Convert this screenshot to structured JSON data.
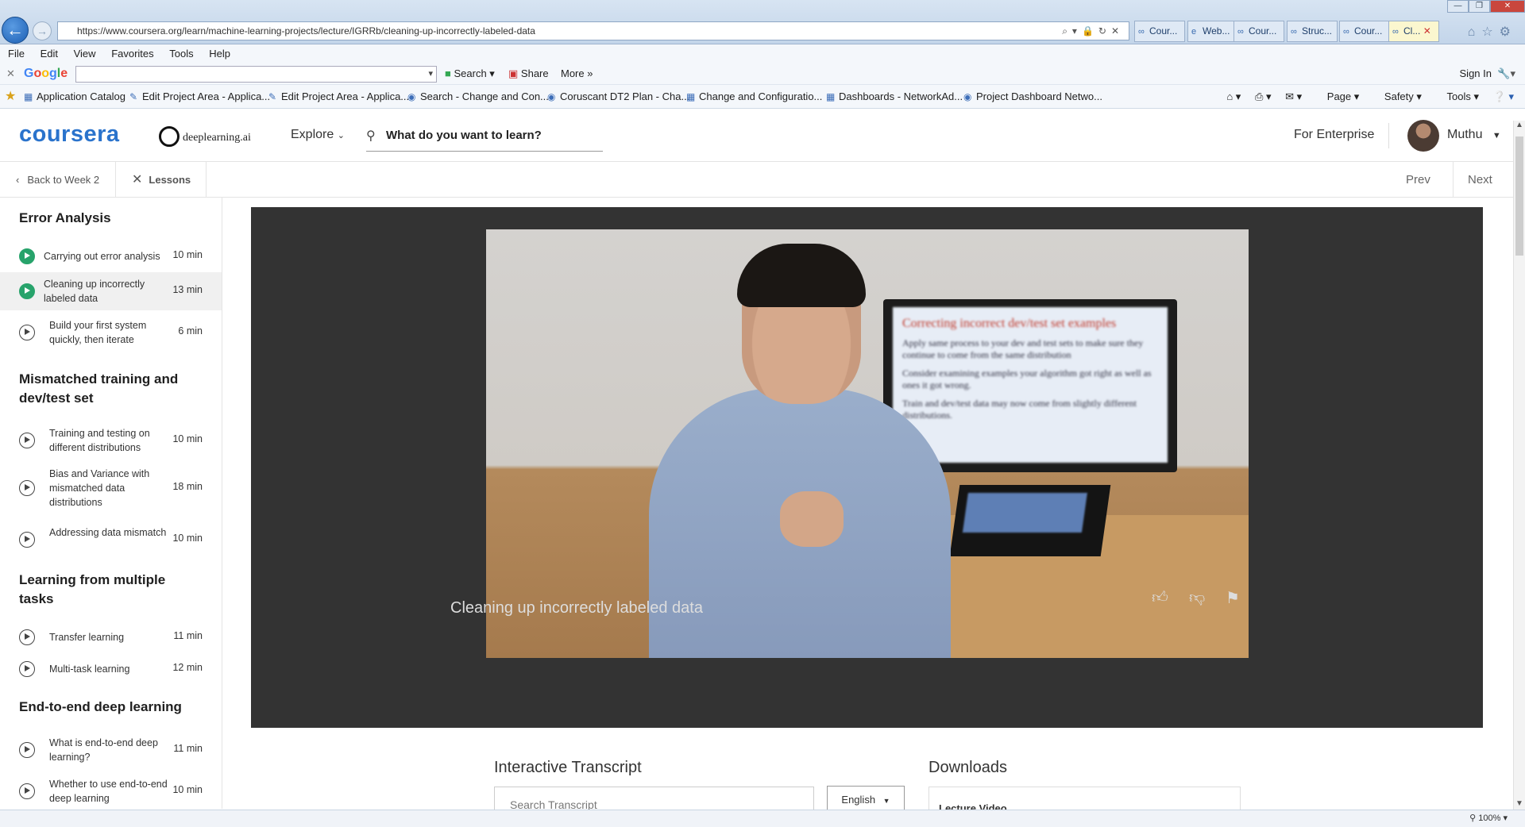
{
  "browser": {
    "url": "https://www.coursera.org/learn/machine-learning-projects/lecture/IGRRb/cleaning-up-incorrectly-labeled-data",
    "tabs": [
      {
        "label": "Cour..."
      },
      {
        "label": "Web..."
      },
      {
        "label": "Cour..."
      },
      {
        "label": "Struc..."
      },
      {
        "label": "Cour..."
      },
      {
        "label": "Cl..."
      }
    ],
    "menu": [
      "File",
      "Edit",
      "View",
      "Favorites",
      "Tools",
      "Help"
    ],
    "google_bar": {
      "logo": "Google",
      "search_label": "Search",
      "share_label": "Share",
      "more_label": "More",
      "signin_label": "Sign In"
    },
    "favorites": [
      "Application Catalog",
      "Edit Project Area - Applica...",
      "Edit Project Area - Applica...",
      "Search - Change and Con...",
      "Coruscant DT2 Plan - Cha...",
      "Change and Configuratio...",
      "Dashboards - NetworkAd...",
      "Project Dashboard Netwo..."
    ],
    "command_bar": {
      "page": "Page",
      "safety": "Safety",
      "tools": "Tools"
    },
    "zoom": "100%"
  },
  "header": {
    "logo": "coursera",
    "partner_logo": "deeplearning.ai",
    "explore": "Explore",
    "search_placeholder": "What do you want to learn?",
    "for_enterprise": "For Enterprise",
    "username": "Muthu"
  },
  "subnav": {
    "back": "Back to Week 2",
    "lessons": "Lessons",
    "prev": "Prev",
    "next": "Next"
  },
  "sidebar": {
    "sections": [
      {
        "title": "Error Analysis"
      },
      {
        "title": "Mismatched training and dev/test set"
      },
      {
        "title": "Learning from multiple tasks"
      },
      {
        "title": "End-to-end deep learning"
      }
    ],
    "lessons": [
      {
        "title": "Carrying out error analysis",
        "time": "10 min",
        "status": "completed"
      },
      {
        "title": "Cleaning up incorrectly labeled data",
        "time": "13 min",
        "status": "completed-active"
      },
      {
        "title": "Build your first system quickly, then iterate",
        "time": "6 min",
        "status": "not-started"
      },
      {
        "title": "Training and testing on different distributions",
        "time": "10 min",
        "status": "not-started"
      },
      {
        "title": "Bias and Variance with mismatched data distributions",
        "time": "18 min",
        "status": "not-started"
      },
      {
        "title": "Addressing data mismatch",
        "time": "10 min",
        "status": "not-started"
      },
      {
        "title": "Transfer learning",
        "time": "11 min",
        "status": "not-started"
      },
      {
        "title": "Multi-task learning",
        "time": "12 min",
        "status": "not-started"
      },
      {
        "title": "What is end-to-end deep learning?",
        "time": "11 min",
        "status": "not-started"
      },
      {
        "title": "Whether to use end-to-end deep learning",
        "time": "10 min",
        "status": "not-started"
      }
    ]
  },
  "video": {
    "caption": "Cleaning up incorrectly labeled data",
    "slide_title": "Correcting incorrect dev/test set examples",
    "slide_bullets": [
      "Apply same process to your dev and test sets to make sure they continue to come from the same distribution",
      "Consider examining examples your algorithm got right as well as ones it got wrong.",
      "Train and dev/test data may now come from slightly different distributions."
    ]
  },
  "transcript": {
    "title": "Interactive Transcript",
    "search_placeholder": "Search Transcript",
    "language": "English"
  },
  "downloads": {
    "title": "Downloads",
    "first_item": "Lecture Video"
  },
  "colors": {
    "coursera_blue": "#2a73cc",
    "completed_green": "#27a36b",
    "player_bg": "#333333"
  }
}
